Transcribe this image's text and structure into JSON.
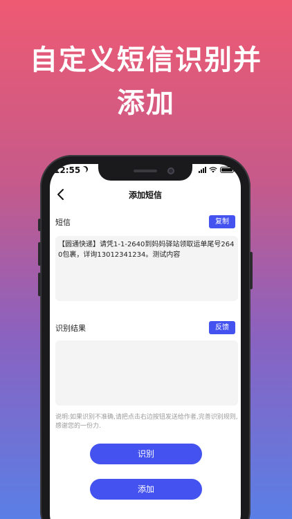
{
  "headline": {
    "line1": "自定义短信识别并",
    "line2": "添加"
  },
  "status_bar": {
    "time": "12:55"
  },
  "nav": {
    "title": "添加短信",
    "back_icon": "chevron-left-icon"
  },
  "sms_section": {
    "label": "短信",
    "copy_button": "复制",
    "content": "【圆通快递】请凭1-1-2640到妈妈驿站领取运单尾号2640包裹，详询13012341234。测试内容"
  },
  "result_section": {
    "label": "识别结果",
    "feedback_button": "反馈",
    "content": ""
  },
  "note": "说明:如果识别不准确,请把点击右边按钮发送给作者,完善识别规则,感谢您的一份力.",
  "actions": {
    "recognize_button": "识别",
    "add_button": "添加"
  },
  "colors": {
    "accent": "#4452f0",
    "gradient_top": "#ee5a72",
    "gradient_bottom": "#5a7fe6"
  }
}
